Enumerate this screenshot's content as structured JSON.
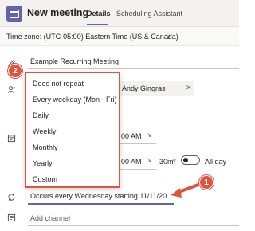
{
  "header": {
    "title": "New meeting",
    "tabs": [
      {
        "label": "Details",
        "active": true
      },
      {
        "label": "Scheduling Assistant",
        "active": false
      }
    ]
  },
  "timezone": {
    "label": "Time zone: (UTC-05:00) Eastern Time (US & Canada)"
  },
  "form": {
    "title_value": "Example Recurring Meeting",
    "attendee": "Andy Gingras",
    "start_time": "00 AM",
    "end_time": "00 AM",
    "duration": "30m",
    "all_day_label": "All day",
    "all_day_on": false,
    "repeat_value": "Occurs every Wednesday starting 11/11/20",
    "channel_placeholder": "Add channel"
  },
  "repeat_menu": {
    "items": [
      "Does not repeat",
      "Every weekday (Mon - Fri)",
      "Daily",
      "Weekly",
      "Monthly",
      "Yearly",
      "Custom"
    ]
  },
  "annotations": {
    "badge_1": "1",
    "badge_2": "2"
  },
  "colors": {
    "accent": "#6264a7",
    "annotation": "#e0533d"
  },
  "icons": [
    "calendar-icon",
    "pencil-icon",
    "add-person-icon",
    "calendar-small-icon",
    "repeat-icon",
    "channel-icon",
    "chevron-down-icon",
    "close-icon"
  ]
}
